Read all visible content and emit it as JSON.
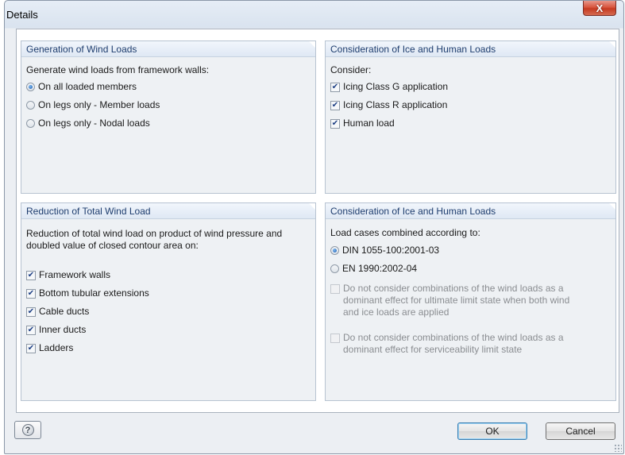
{
  "window": {
    "title": "Details",
    "close_glyph": "X"
  },
  "panels": {
    "wind_generation": {
      "title": "Generation of Wind Loads",
      "prompt": "Generate wind loads from framework walls:",
      "options": [
        {
          "label": "On all loaded members",
          "selected": true
        },
        {
          "label": "On legs only - Member loads",
          "selected": false
        },
        {
          "label": "On legs only - Nodal loads",
          "selected": false
        }
      ]
    },
    "ice_human": {
      "title": "Consideration of Ice and Human Loads",
      "prompt": "Consider:",
      "options": [
        {
          "label": "Icing Class G application",
          "checked": true
        },
        {
          "label": "Icing Class R application",
          "checked": true
        },
        {
          "label": "Human load",
          "checked": true
        }
      ]
    },
    "reduction": {
      "title": "Reduction of Total Wind Load",
      "prompt_line1": "Reduction of total wind load on product of wind pressure and",
      "prompt_line2": "doubled value of closed contour area on:",
      "options": [
        {
          "label": "Framework walls",
          "checked": true
        },
        {
          "label": "Bottom tubular extensions",
          "checked": true
        },
        {
          "label": "Cable ducts",
          "checked": true
        },
        {
          "label": "Inner ducts",
          "checked": true
        },
        {
          "label": "Ladders",
          "checked": true
        }
      ]
    },
    "combination": {
      "title": "Consideration of Ice and Human Loads",
      "prompt": "Load cases combined according to:",
      "standards": [
        {
          "label": "DIN 1055-100:2001-03",
          "selected": true
        },
        {
          "label": "EN 1990:2002-04",
          "selected": false
        }
      ],
      "option_uls": {
        "line1": "Do not consider combinations of the wind loads as a",
        "line2": "dominant effect for ultimate limit state when both wind",
        "line3": "and ice loads are applied",
        "checked": false,
        "enabled": false
      },
      "option_sls": {
        "line1": "Do not consider combinations of the wind loads as a",
        "line2": "dominant effect for serviceability limit state",
        "checked": false,
        "enabled": false
      }
    }
  },
  "footer": {
    "help_glyph": "?",
    "ok_label": "OK",
    "cancel_label": "Cancel"
  },
  "check_glyph": "✔"
}
